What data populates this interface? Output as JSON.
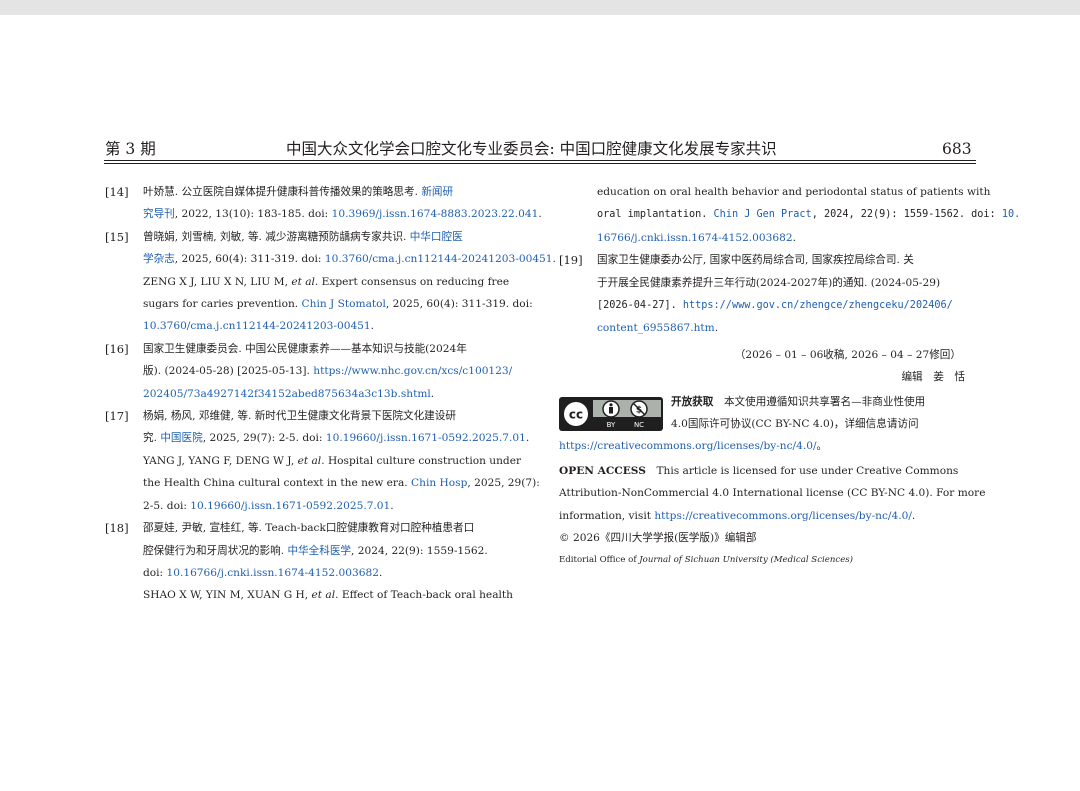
{
  "header": {
    "issue": "第 3 期",
    "article_title": "中国大众文化学会口腔文化专业委员会: 中国口腔健康文化发展专家共识",
    "page_number": "683"
  },
  "refs": {
    "r14": {
      "num": "[14]",
      "l1": "叶娇慧. 公立医院自媒体提升健康科普传播效果的策略思考. ",
      "l1_journal": "新闻研",
      "l2_journal": "究导刊",
      "l2": ", 2022, 13(10): 183-185. doi: ",
      "l2_doi": "10.3969/j.issn.1674-8883.2023.22.041",
      "l2_end": "."
    },
    "r15": {
      "num": "[15]",
      "l1": "曾晓娟, 刘雪楠, 刘敏, 等. 减少游离糖预防龋病专家共识. ",
      "l1_journal": "中华口腔医",
      "l2_journal": "学杂志",
      "l2": ", 2025, 60(4): 311-319. doi: ",
      "l2_doi": "10.3760/cma.j.cn112144-20241203-00451",
      "l2_end": ".",
      "l3": "ZENG X J, LIU X N, LIU M, ",
      "l3_etal": "et al",
      "l3_end": ". Expert consensus on reducing free",
      "l4": "sugars for caries prevention. ",
      "l4_journal": "Chin J Stomatol",
      "l4_end": ", 2025, 60(4): 311-319. doi:",
      "l5_doi": "10.3760/cma.j.cn112144-20241203-00451",
      "l5_end": "."
    },
    "r16": {
      "num": "[16]",
      "l1": "国家卫生健康委员会. 中国公民健康素养——基本知识与技能(2024年",
      "l2": "版). (2024-05-28) [2025-05-13]. ",
      "l2_url": "https://www.nhc.gov.cn/xcs/c100123/",
      "l3_url": "202405/73a4927142f34152abed875634a3c13b.shtml",
      "l3_end": "."
    },
    "r17": {
      "num": "[17]",
      "l1": "杨娟, 杨风, 邓维健, 等. 新时代卫生健康文化背景下医院文化建设研",
      "l2": "究. ",
      "l2_journal": "中国医院",
      "l2_mid": ", 2025, 29(7): 2-5. doi: ",
      "l2_doi": "10.19660/j.issn.1671-0592.2025.7.01",
      "l2_end": ".",
      "l3": "YANG J, YANG F, DENG W J, ",
      "l3_etal": "et al",
      "l3_end": ". Hospital culture construction under",
      "l4": "the Health China cultural context in the new era. ",
      "l4_journal": "Chin Hosp",
      "l4_end": ", 2025, 29(7):",
      "l5": "2-5. doi: ",
      "l5_doi": "10.19660/j.issn.1671-0592.2025.7.01",
      "l5_end": "."
    },
    "r18": {
      "num": "[18]",
      "l1": "邵夏娃, 尹敏, 宣桂红, 等. Teach-back口腔健康教育对口腔种植患者口",
      "l2": "腔保健行为和牙周状况的影响. ",
      "l2_journal": "中华全科医学",
      "l2_end": ", 2024, 22(9): 1559-1562.",
      "l3": "doi: ",
      "l3_doi": "10.16766/j.cnki.issn.1674-4152.003682",
      "l3_end": ".",
      "l4": "SHAO X W, YIN M, XUAN G H, ",
      "l4_etal": "et al",
      "l4_end": ". Effect of Teach-back oral health",
      "r1": "education on oral health behavior and periodontal status of patients with",
      "r2": "oral implantation. ",
      "r2_journal": "Chin J Gen Pract",
      "r2_mid": ", 2024, 22(9): 1559-1562. doi: ",
      "r2_doi": "10.",
      "r3_doi": "16766/j.cnki.issn.1674-4152.003682",
      "r3_end": "."
    },
    "r19": {
      "num": "[19]",
      "l1": "国家卫生健康委办公厅, 国家中医药局综合司, 国家疾控局综合司. 关",
      "l2": "于开展全民健康素养提升三年行动(2024-2027年)的通知. (2024-05-29)",
      "l3": "[2026-04-27]. ",
      "l3_url": "https://www.gov.cn/zhengce/zhengceku/202406/",
      "l4_url": "content_6955867.htm",
      "l4_end": "."
    }
  },
  "received": "（2026 – 01 – 06收稿, 2026 – 04 – 27修回）",
  "editor": "编辑　姜　恬",
  "license": {
    "badge_cc": "cc",
    "badge_by": "BY",
    "badge_nc": "NC",
    "cn_heading": "开放获取",
    "cn_l1": "　本文使用遵循知识共享署名—非商业性使用",
    "cn_l2": "4.0国际许可协议(CC BY-NC 4.0)，详细信息请访问",
    "cn_url": "https://creativecommons.org/licenses/by-nc/4.0/",
    "cn_url_end": "。",
    "en_heading": "OPEN ACCESS",
    "en_l1": "　This article is licensed for use under Creative Commons",
    "en_l2": "Attribution-NonCommercial 4.0 International license (CC BY-NC 4.0). For more",
    "en_l3": "information, visit ",
    "en_url": "https://creativecommons.org/licenses/by-nc/4.0/",
    "en_url_end": ".",
    "copyright": "© 2026《四川大学学报(医学版)》编辑部",
    "office_pre": "Editorial Office of ",
    "office_journal": "Journal of Sichuan University (Medical Sciences)"
  }
}
